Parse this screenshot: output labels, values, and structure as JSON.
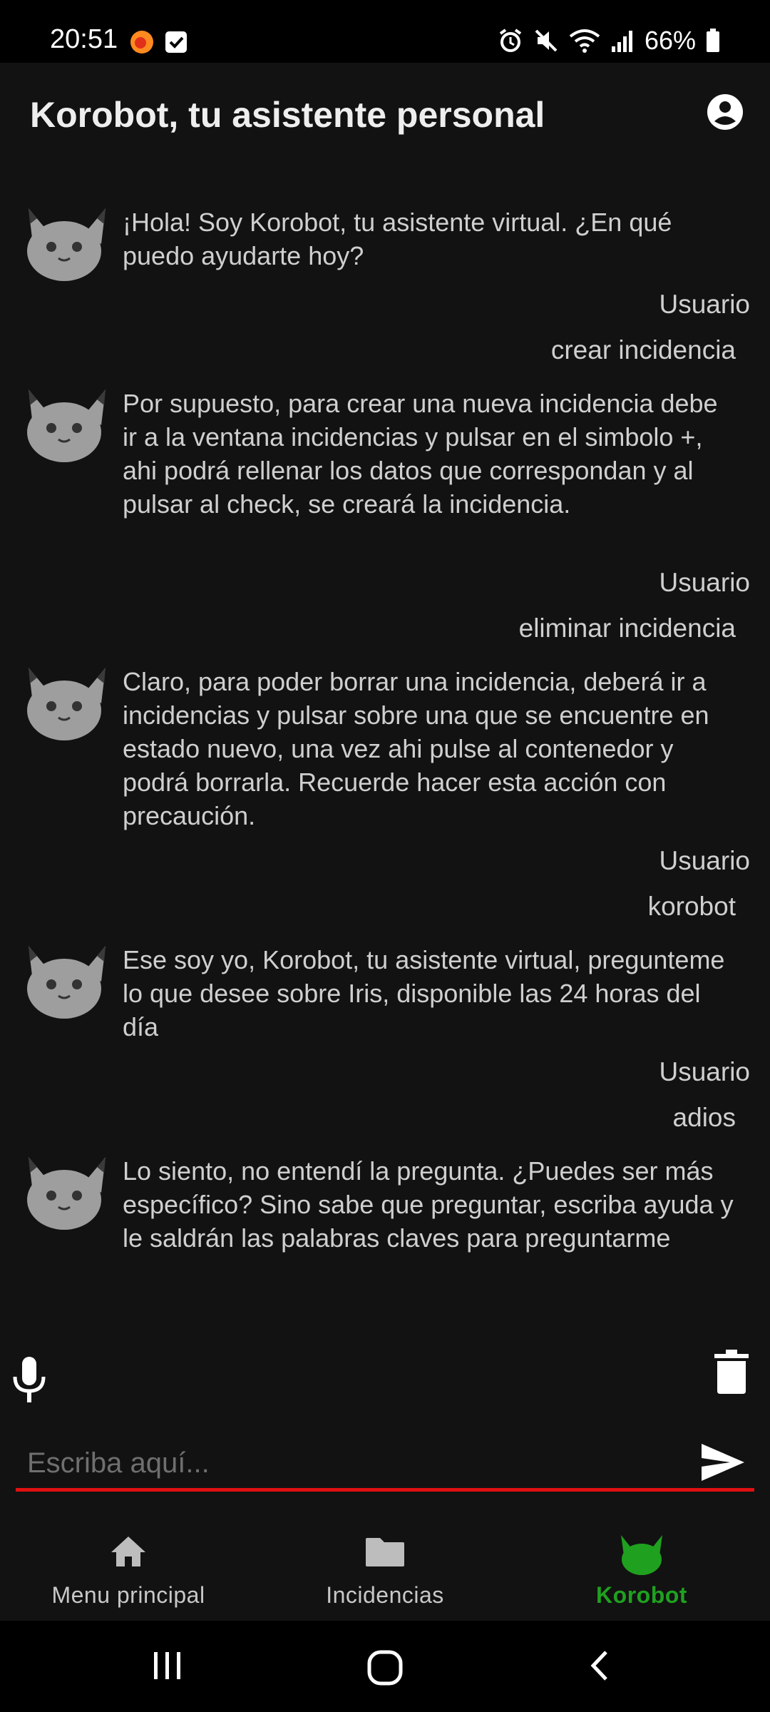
{
  "status_bar": {
    "time": "20:51",
    "battery": "66%"
  },
  "app_bar": {
    "title": "Korobot, tu asistente personal"
  },
  "messages": [
    {
      "type": "bot",
      "text": "¡Hola! Soy Korobot, tu asistente virtual. ¿En qué puedo ayudarte hoy?"
    },
    {
      "type": "user",
      "label": "Usuario",
      "text": "crear incidencia"
    },
    {
      "type": "bot",
      "text": "Por supuesto, para crear una nueva incidencia debe ir a la ventana incidencias y pulsar en el simbolo +, ahi podrá rellenar los datos que correspondan y al pulsar al check, se creará la incidencia."
    },
    {
      "type": "user",
      "label": "Usuario",
      "text": "eliminar incidencia"
    },
    {
      "type": "bot",
      "text": "Claro, para poder borrar una incidencia, deberá ir a incidencias y pulsar sobre una que se encuentre en estado nuevo, una vez ahi pulse al contenedor y podrá borrarla. Recuerde hacer esta acción con precaución."
    },
    {
      "type": "user",
      "label": "Usuario",
      "text": "korobot"
    },
    {
      "type": "bot",
      "text": "Ese soy yo, Korobot, tu asistente virtual, pregunteme lo que desee sobre Iris, disponible las 24 horas del día"
    },
    {
      "type": "user",
      "label": "Usuario",
      "text": "adios"
    },
    {
      "type": "bot",
      "text": "Lo siento, no entendí la pregunta. ¿Puedes ser más específico? Sino sabe que preguntar, escriba ayuda y le saldrán las palabras claves para preguntarme"
    }
  ],
  "input": {
    "placeholder": "Escriba aquí..."
  },
  "bottom_nav": {
    "items": [
      {
        "label": "Menu principal",
        "icon": "home-icon",
        "active": false
      },
      {
        "label": "Incidencias",
        "icon": "folder-icon",
        "active": false
      },
      {
        "label": "Korobot",
        "icon": "korobot-icon",
        "active": true
      }
    ]
  },
  "colors": {
    "background": "#121212",
    "accent_active": "#1fa11f",
    "input_underline": "#e01010"
  }
}
